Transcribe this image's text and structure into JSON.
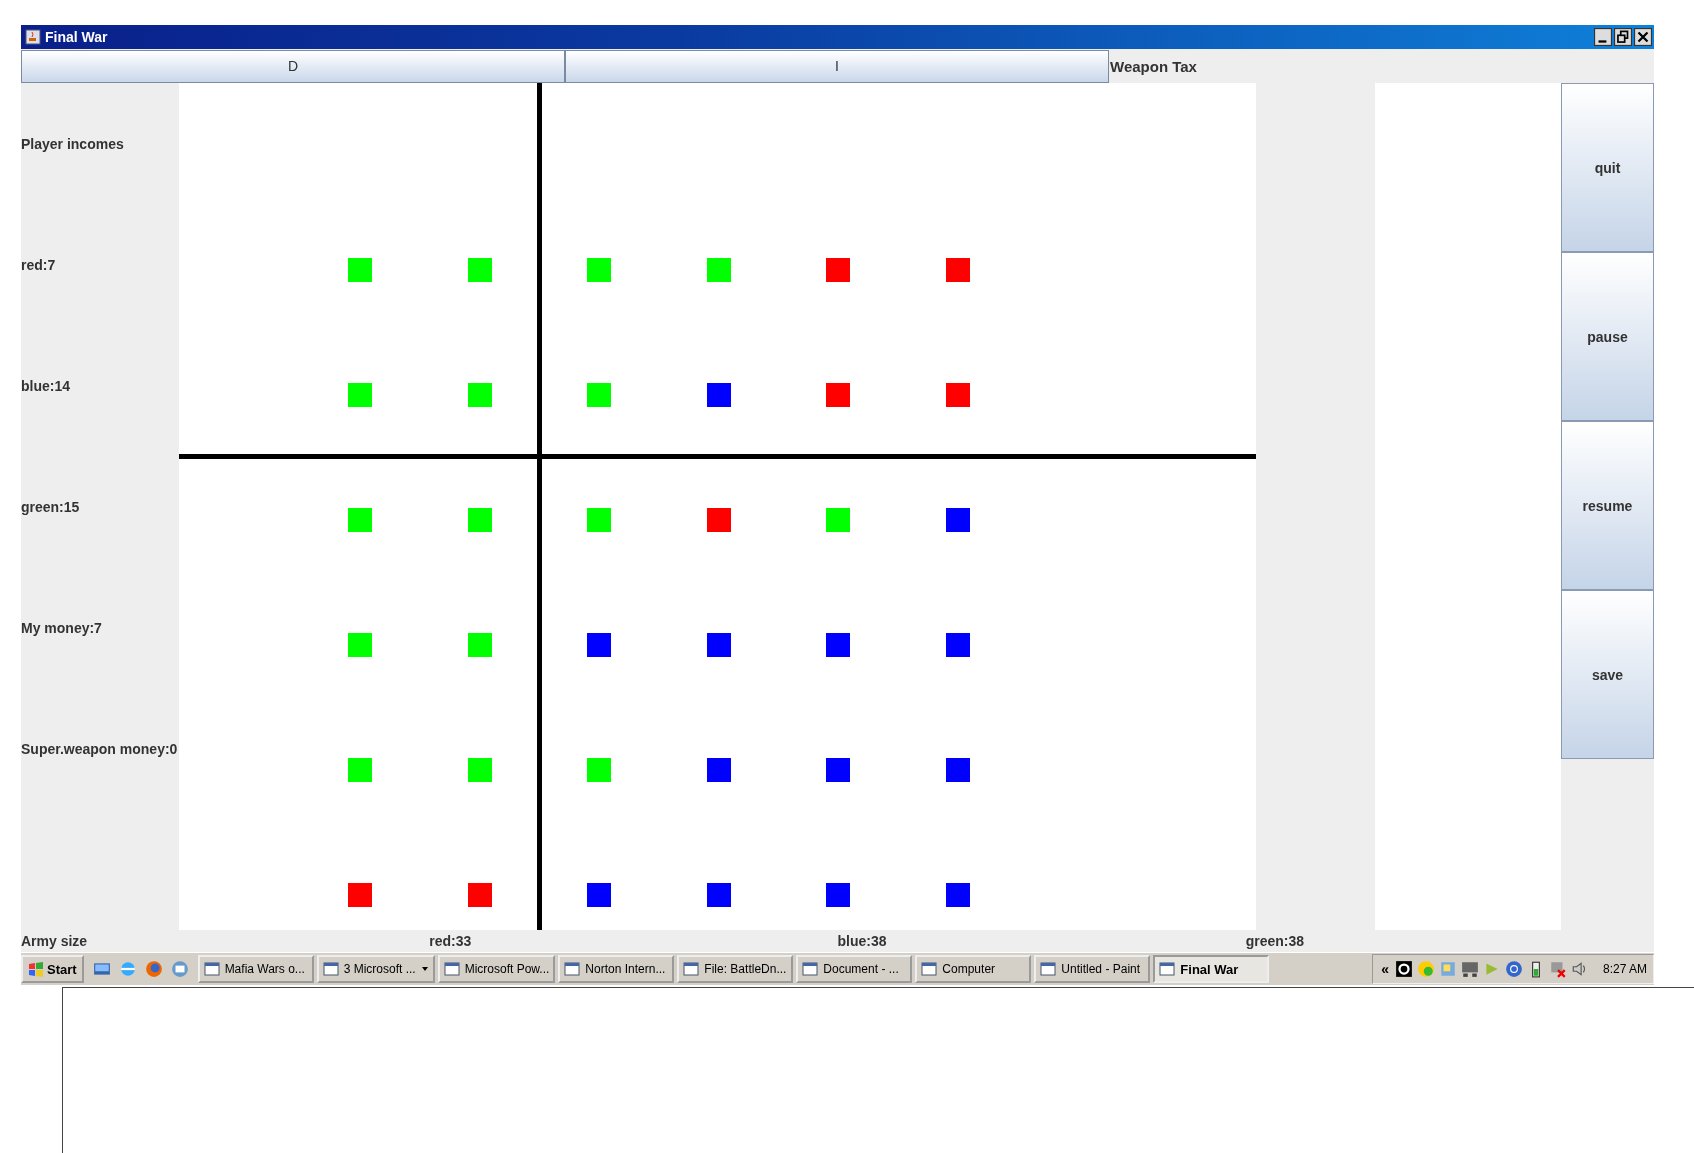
{
  "window": {
    "title": "Final War"
  },
  "toolbar": {
    "buttons": [
      "D",
      "I"
    ],
    "label": "Weapon Tax"
  },
  "incomes": [
    "Player incomes",
    "red:7",
    "blue:14",
    "green:15",
    "My money:7",
    "Super.weapon money:0"
  ],
  "board": {
    "rows": [
      {
        "cells": [
          {
            "color": "#00ff00"
          },
          {
            "color": "#00ff00"
          },
          {
            "color": "#00ff00"
          },
          {
            "color": "#00ff00"
          },
          {
            "color": "#ff0000"
          },
          {
            "color": "#ff0000"
          }
        ]
      },
      {
        "cells": [
          {
            "color": "#00ff00"
          },
          {
            "color": "#00ff00"
          },
          {
            "color": "#00ff00"
          },
          {
            "color": "#0000ff"
          },
          {
            "color": "#ff0000"
          },
          {
            "color": "#ff0000"
          }
        ]
      },
      {
        "cells": [
          {
            "color": "#00ff00"
          },
          {
            "color": "#00ff00"
          },
          {
            "color": "#00ff00"
          },
          {
            "color": "#ff0000"
          },
          {
            "color": "#00ff00"
          },
          {
            "color": "#0000ff"
          }
        ]
      },
      {
        "cells": [
          {
            "color": "#00ff00"
          },
          {
            "color": "#00ff00"
          },
          {
            "color": "#0000ff"
          },
          {
            "color": "#0000ff"
          },
          {
            "color": "#0000ff"
          },
          {
            "color": "#0000ff"
          }
        ]
      },
      {
        "cells": [
          {
            "color": "#00ff00"
          },
          {
            "color": "#00ff00"
          },
          {
            "color": "#00ff00"
          },
          {
            "color": "#0000ff"
          },
          {
            "color": "#0000ff"
          },
          {
            "color": "#0000ff"
          }
        ]
      },
      {
        "cells": [
          {
            "color": "#ff0000"
          },
          {
            "color": "#ff0000"
          },
          {
            "color": "#0000ff"
          },
          {
            "color": "#0000ff"
          },
          {
            "color": "#0000ff"
          },
          {
            "color": "#0000ff"
          }
        ]
      }
    ]
  },
  "army": [
    "Army size",
    "red:33",
    "blue:38",
    "green:38"
  ],
  "controls": [
    "quit",
    "pause",
    "resume",
    "save"
  ],
  "taskbar": {
    "start": "Start",
    "tasks": [
      {
        "label": "Mafia Wars o...",
        "selected": false,
        "grouped": false
      },
      {
        "label": "3 Microsoft ...",
        "selected": false,
        "grouped": true
      },
      {
        "label": "Microsoft Pow...",
        "selected": false,
        "grouped": false
      },
      {
        "label": "Norton Intern...",
        "selected": false,
        "grouped": false
      },
      {
        "label": "File: BattleDn...",
        "selected": false,
        "grouped": false
      },
      {
        "label": "Document - ...",
        "selected": false,
        "grouped": false
      },
      {
        "label": "Computer",
        "selected": false,
        "grouped": false
      },
      {
        "label": "Untitled - Paint",
        "selected": false,
        "grouped": false
      },
      {
        "label": "Final War",
        "selected": true,
        "grouped": false
      }
    ],
    "tray_toggle": "«",
    "clock": "8:27 AM"
  }
}
